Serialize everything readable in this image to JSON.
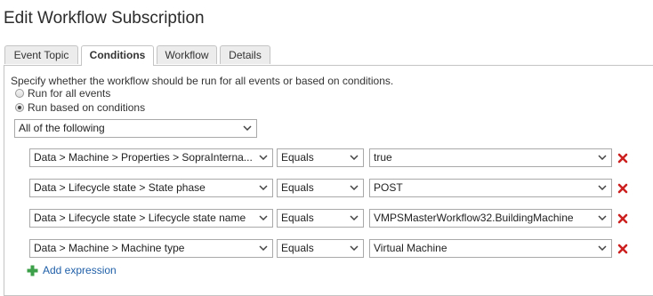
{
  "page": {
    "title": "Edit Workflow Subscription"
  },
  "tabs": [
    {
      "label": "Event Topic"
    },
    {
      "label": "Conditions"
    },
    {
      "label": "Workflow"
    },
    {
      "label": "Details"
    }
  ],
  "conditions": {
    "description": "Specify whether the workflow should be run for all events or based on conditions.",
    "radio_all_label": "Run for all events",
    "radio_conditions_label": "Run based on conditions",
    "selected_radio": "Run based on conditions",
    "clause_select": "All of the following",
    "expressions": [
      {
        "field": "Data > Machine > Properties > SopraInterna...",
        "operator": "Equals",
        "value": "true"
      },
      {
        "field": "Data > Lifecycle state > State phase",
        "operator": "Equals",
        "value": "POST"
      },
      {
        "field": "Data > Lifecycle state > Lifecycle state name",
        "operator": "Equals",
        "value": "VMPSMasterWorkflow32.BuildingMachine"
      },
      {
        "field": "Data > Machine > Machine type",
        "operator": "Equals",
        "value": "Virtual Machine"
      }
    ],
    "add_expression_label": "Add expression"
  },
  "colors": {
    "delete": "#cc1f1f",
    "add": "#3ca04a",
    "link": "#1f5fa8"
  },
  "icons": {
    "delete": "delete-x-icon",
    "add": "plus-icon",
    "dropdown": "chevron-down-icon"
  }
}
